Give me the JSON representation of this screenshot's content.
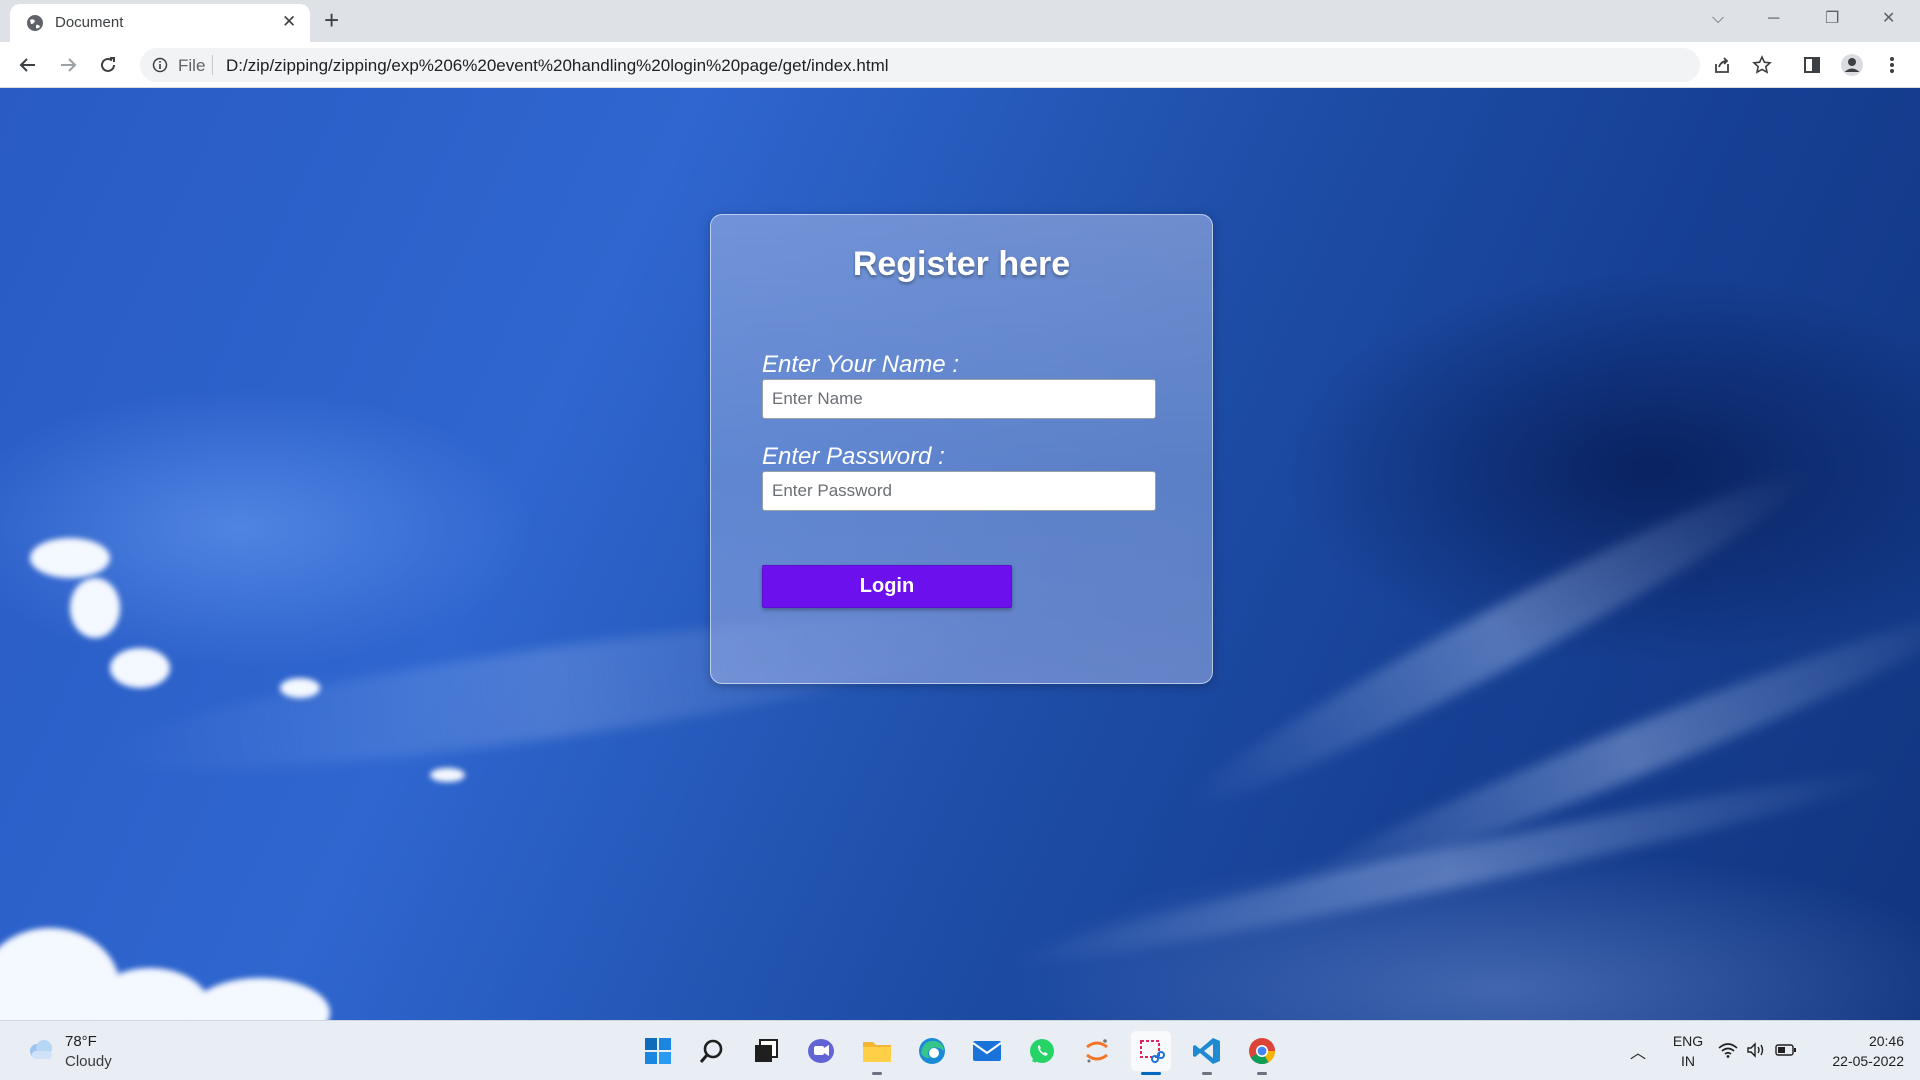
{
  "browser": {
    "tab_title": "Document",
    "tab_close_glyph": "✕",
    "new_tab_glyph": "+",
    "url_scheme_label": "File",
    "url": "D:/zip/zipping/zipping/exp%206%20event%20handling%20login%20page/get/index.html",
    "icons": [
      "globe-icon",
      "back-icon",
      "forward-icon",
      "reload-icon",
      "info-icon",
      "share-icon",
      "star-icon",
      "side-panel-icon",
      "profile-icon",
      "menu-icon"
    ]
  },
  "window_controls": {
    "tab_search": "⌵",
    "minimize": "─",
    "restore": "❐",
    "close": "✕"
  },
  "form": {
    "title": "Register here",
    "name_label": "Enter Your Name :",
    "name_placeholder": "Enter Name",
    "name_value": "",
    "password_label": "Enter Password :",
    "password_placeholder": "Enter Password",
    "password_value": "",
    "login_label": "Login"
  },
  "taskbar": {
    "weather_temp": "78°F",
    "weather_desc": "Cloudy",
    "apps": [
      "start",
      "search",
      "task-view",
      "teams-chat",
      "file-explorer",
      "edge",
      "mail",
      "whatsapp",
      "jupyter",
      "snipping-tool",
      "vscode",
      "chrome"
    ],
    "tray_up_arrow": "︿",
    "language": "ENG",
    "region": "IN",
    "time": "20:46",
    "date": "22-05-2022"
  },
  "colors": {
    "login_button": "#6c10ee",
    "chrome_frame": "#dee1e6",
    "taskbar": "#e9eef5"
  }
}
